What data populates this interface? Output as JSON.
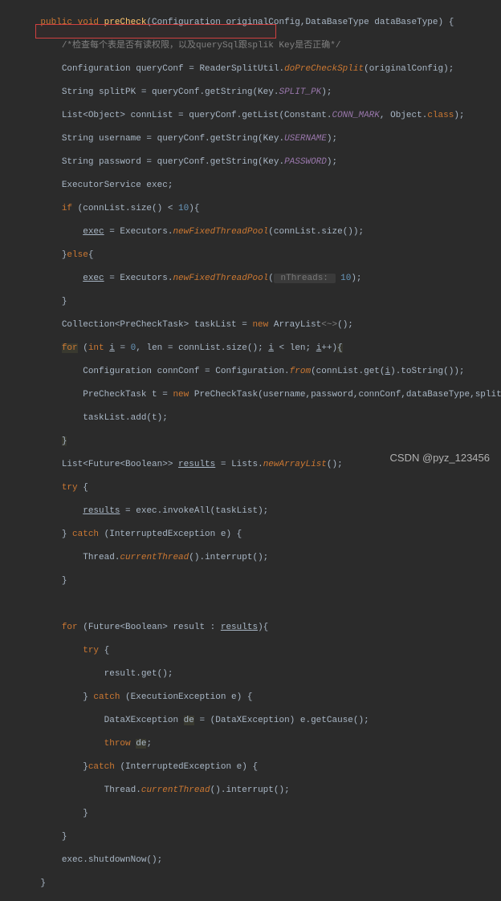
{
  "code": {
    "l1_p1": "public void ",
    "l1_method": "preCheck",
    "l1_p2": "(Configuration originalConfig,DataBaseType dataBaseType) {",
    "l2_comment": "/*检查每个表是否有读权限，以及querySql跟splik Key是否正确*/",
    "l3_p1": "Configuration queryConf = ReaderSplitUtil.",
    "l3_m": "doPreCheckSplit",
    "l3_p2": "(originalConfig);",
    "l4_p1": "String splitPK = queryConf.getString(Key.",
    "l4_f": "SPLIT_PK",
    "l4_p2": ");",
    "l5_p1": "List<Object> connList = queryConf.getList(Constant.",
    "l5_f": "CONN_MARK",
    "l5_p2": ", Object.",
    "l5_kw": "class",
    "l5_p3": ");",
    "l6_p1": "String username = queryConf.getString(Key.",
    "l6_f": "USERNAME",
    "l6_p2": ");",
    "l7_p1": "String password = queryConf.getString(Key.",
    "l7_f": "PASSWORD",
    "l7_p2": ");",
    "l8": "ExecutorService exec;",
    "l9_p1": "if",
    "l9_p2": " (connList.size() < ",
    "l9_n": "10",
    "l9_p3": "){",
    "l10_p1": "exec",
    "l10_p2": " = Executors.",
    "l10_m": "newFixedThreadPool",
    "l10_p3": "(connList.size());",
    "l11_p1": "}",
    "l11_kw": "else",
    "l11_p2": "{",
    "l12_p1": "exec",
    "l12_p2": " = Executors.",
    "l12_m": "newFixedThreadPool",
    "l12_p3": "(",
    "l12_hint": " nThreads: ",
    "l12_n": "10",
    "l12_p4": ");",
    "l13": "}",
    "l14_p1": "Collection<PreCheckTask> taskList = ",
    "l14_kw": "new",
    "l14_p2": " ArrayList",
    "l14_g": "<~>",
    "l14_p3": "();",
    "l15_kw": "for",
    "l15_p1": " (",
    "l15_kw2": "int",
    "l15_p2": " ",
    "l15_v": "i",
    "l15_p3": " = ",
    "l15_n1": "0",
    "l15_p4": ", len = connList.size(); ",
    "l15_v2": "i",
    "l15_p5": " < len; ",
    "l15_v3": "i",
    "l15_p6": "++)",
    "l15_p7": "{",
    "l16_p1": "Configuration connConf = Configuration.",
    "l16_m": "from",
    "l16_p2": "(connList.get(",
    "l16_v": "i",
    "l16_p3": ").toString());",
    "l17_p1": "PreCheckTask t = ",
    "l17_kw": "new",
    "l17_p2": " PreCheckTask(username,password,connConf,dataBaseType,splitPK);",
    "l18_p1": "taskList.add(t);",
    "l19": "}",
    "l20_p1": "List<Future<Boolean>> ",
    "l20_v": "results",
    "l20_p2": " = Lists.",
    "l20_m": "newArrayList",
    "l20_p3": "();",
    "l21_kw": "try",
    "l21_p1": " {",
    "l22_v": "results",
    "l22_p1": " = exec.invokeAll(taskList);",
    "l23_p1": "} ",
    "l23_kw": "catch",
    "l23_p2": " (InterruptedException e) {",
    "l24_p1": "Thread.",
    "l24_m": "currentThread",
    "l24_p2": "().interrupt();",
    "l25": "}",
    "l27_kw": "for",
    "l27_p1": " (Future<Boolean> result : ",
    "l27_v": "results",
    "l27_p2": "){",
    "l28_kw": "try",
    "l28_p1": " {",
    "l29": "result.get();",
    "l30_p1": "} ",
    "l30_kw": "catch",
    "l30_p2": " (ExecutionException e) {",
    "l31_p1": "DataXException ",
    "l31_v": "de",
    "l31_p2": " = (DataXException) e.getCause();",
    "l32_kw": "throw",
    "l32_p1": " ",
    "l32_v": "de",
    "l32_p2": ";",
    "l33_p1": "}",
    "l33_kw": "catch",
    "l33_p2": " (InterruptedException e) {",
    "l34_p1": "Thread.",
    "l34_m": "currentThread",
    "l34_p2": "().interrupt();",
    "l35": "}",
    "l36": "}",
    "l37": "exec.shutdownNow();",
    "l38": "}"
  },
  "watermark": "CSDN @pyz_123456"
}
